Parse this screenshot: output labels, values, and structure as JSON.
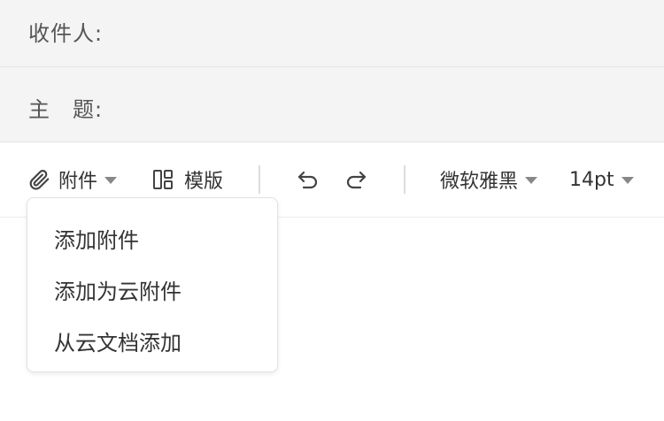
{
  "compose": {
    "recipient_label": "收件人:",
    "subject_label": "主　题:",
    "recipient_value": "",
    "subject_value": ""
  },
  "toolbar": {
    "attachment_label": "附件",
    "template_label": "模版",
    "font_family": "微软雅黑",
    "font_size": "14pt",
    "icons": [
      "paperclip-icon",
      "template-layout-icon",
      "undo-icon",
      "redo-icon",
      "chevron-down-icon"
    ]
  },
  "attachment_menu": {
    "items": [
      "添加附件",
      "添加为云附件",
      "从云文档添加"
    ]
  },
  "colors": {
    "header_bg": "#f4f4f4",
    "text": "#333333",
    "caret": "#888888",
    "divider": "#dddddd"
  }
}
